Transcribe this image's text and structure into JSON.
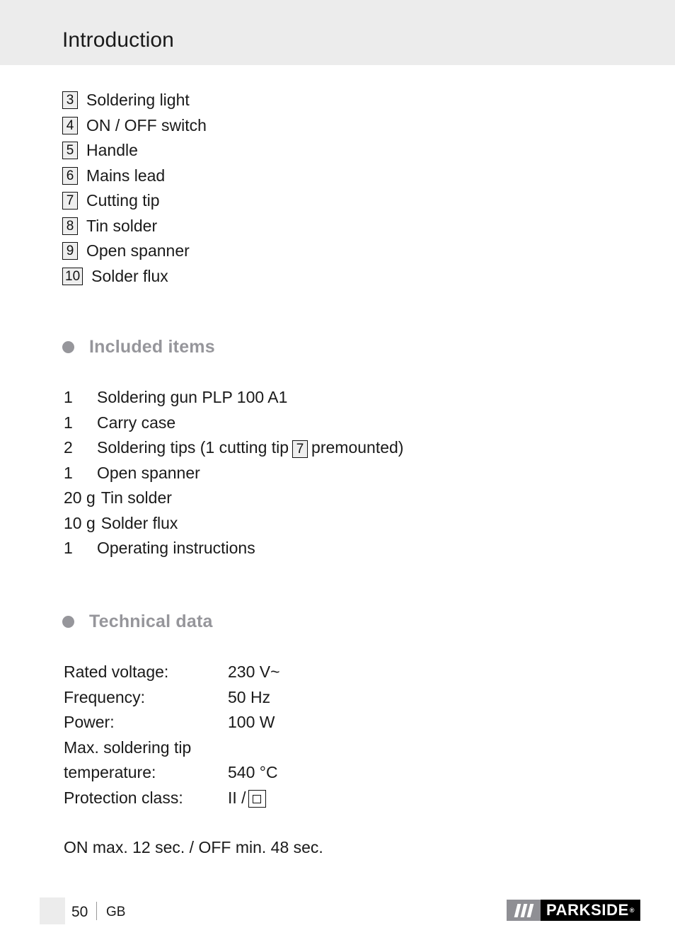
{
  "header": {
    "title": "Introduction",
    "band_color": "#ececec"
  },
  "parts_list": {
    "items": [
      {
        "number": "3",
        "label": "Soldering light"
      },
      {
        "number": "4",
        "label": "ON / OFF switch"
      },
      {
        "number": "5",
        "label": "Handle"
      },
      {
        "number": "6",
        "label": "Mains lead"
      },
      {
        "number": "7",
        "label": "Cutting tip"
      },
      {
        "number": "8",
        "label": "Tin solder"
      },
      {
        "number": "9",
        "label": "Open spanner"
      },
      {
        "number": "10",
        "label": "Solder flux"
      }
    ]
  },
  "included_items": {
    "heading": "Included items",
    "bullet_color": "#96969b",
    "rows": [
      {
        "qty": "1",
        "text": "Soldering gun PLP 100 A1"
      },
      {
        "qty": "1",
        "text": "Carry case"
      },
      {
        "qty": "2",
        "text_before": "Soldering tips (1 cutting tip",
        "box": "7",
        "text_after": "premounted)"
      },
      {
        "qty": "1",
        "text": "Open spanner"
      },
      {
        "qty": "20 g",
        "text": "Tin solder"
      },
      {
        "qty": "10 g",
        "text": "Solder flux"
      },
      {
        "qty": "1",
        "text": "Operating instructions"
      }
    ]
  },
  "technical_data": {
    "heading": "Technical data",
    "bullet_color": "#96969b",
    "rows": [
      {
        "label": "Rated voltage:",
        "value": "230 V~"
      },
      {
        "label": "Frequency:",
        "value": "50 Hz"
      },
      {
        "label": "Power:",
        "value": "100 W"
      },
      {
        "label": "Max. soldering tip",
        "value": ""
      },
      {
        "label": "temperature:",
        "value": "540 °C"
      },
      {
        "label": "Protection class:",
        "value": "II /",
        "symbol": "double-insulation"
      }
    ],
    "duty_cycle": "ON max. 12 sec. / OFF min. 48 sec."
  },
  "footer": {
    "page_number": "50",
    "country_code": "GB",
    "logo": {
      "word": "PARKSIDE",
      "registered": "®",
      "slash_block_color": "#8f8f94",
      "word_block_color": "#000000"
    }
  }
}
